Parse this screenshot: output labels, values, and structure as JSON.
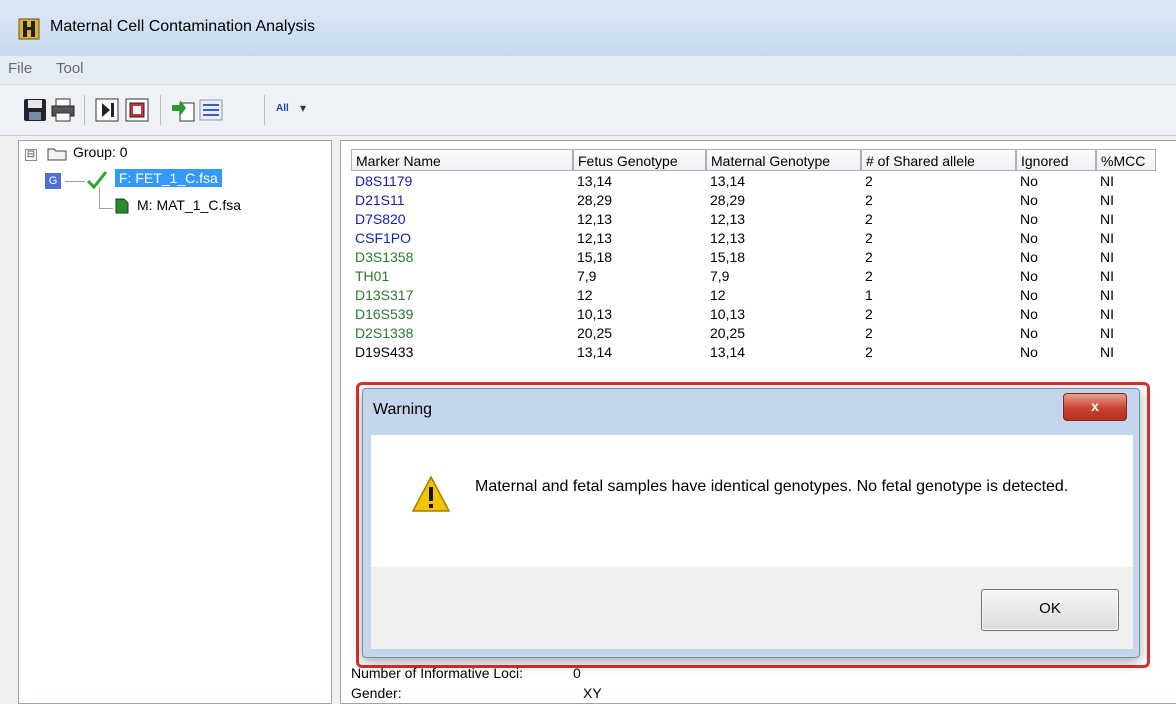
{
  "window": {
    "title": "Maternal Cell Contamination Analysis",
    "icon": "app-icon"
  },
  "menu": {
    "file": "File",
    "tool": "Tool"
  },
  "toolbar": {
    "icons": [
      "save-icon",
      "print-icon",
      "step-icon",
      "export-icon",
      "add-icon",
      "list-icon",
      "all-markers-icon",
      "dropdown-arrow-icon"
    ],
    "all_label": "All"
  },
  "tree": {
    "group_label": "Group: 0",
    "group_badge": "G",
    "expander": "⊟",
    "fetus_file": "F: FET_1_C.fsa",
    "mother_file": "M: MAT_1_C.fsa"
  },
  "table": {
    "columns": [
      "Marker Name",
      "Fetus Genotype",
      "Maternal Genotype",
      "# of Shared allele",
      "Ignored",
      "%MCC"
    ],
    "rows": [
      {
        "marker": "D8S1179",
        "color": "blue",
        "fetus": "13,14",
        "maternal": "13,14",
        "shared": "2",
        "ignored": "No",
        "mcc": "NI"
      },
      {
        "marker": "D21S11",
        "color": "blue",
        "fetus": "28,29",
        "maternal": "28,29",
        "shared": "2",
        "ignored": "No",
        "mcc": "NI"
      },
      {
        "marker": "D7S820",
        "color": "blue",
        "fetus": "12,13",
        "maternal": "12,13",
        "shared": "2",
        "ignored": "No",
        "mcc": "NI"
      },
      {
        "marker": "CSF1PO",
        "color": "blue",
        "fetus": "12,13",
        "maternal": "12,13",
        "shared": "2",
        "ignored": "No",
        "mcc": "NI"
      },
      {
        "marker": "D3S1358",
        "color": "green",
        "fetus": "15,18",
        "maternal": "15,18",
        "shared": "2",
        "ignored": "No",
        "mcc": "NI"
      },
      {
        "marker": "TH01",
        "color": "green",
        "fetus": "7,9",
        "maternal": "7,9",
        "shared": "2",
        "ignored": "No",
        "mcc": "NI"
      },
      {
        "marker": "D13S317",
        "color": "green",
        "fetus": "12",
        "maternal": "12",
        "shared": "1",
        "ignored": "No",
        "mcc": "NI"
      },
      {
        "marker": "D16S539",
        "color": "green",
        "fetus": "10,13",
        "maternal": "10,13",
        "shared": "2",
        "ignored": "No",
        "mcc": "NI"
      },
      {
        "marker": "D2S1338",
        "color": "green",
        "fetus": "20,25",
        "maternal": "20,25",
        "shared": "2",
        "ignored": "No",
        "mcc": "NI"
      },
      {
        "marker": "D19S433",
        "color": "black",
        "fetus": "13,14",
        "maternal": "13,14",
        "shared": "2",
        "ignored": "No",
        "mcc": "NI"
      }
    ],
    "footer": [
      {
        "label": "Number of Informative Loci:",
        "value": "0"
      },
      {
        "label": "Gender:",
        "value": "XY"
      }
    ]
  },
  "dialog": {
    "title": "Warning",
    "close_label": "x",
    "message": "Maternal and fetal samples have identical genotypes. No fetal genotype is detected.",
    "ok_label": "OK",
    "icon": "warning-icon"
  },
  "colors": {
    "marker_blue": "#1a1ab4",
    "marker_green": "#2b7a2b",
    "selection": "#3399ff",
    "highlight_border": "#d83030"
  }
}
